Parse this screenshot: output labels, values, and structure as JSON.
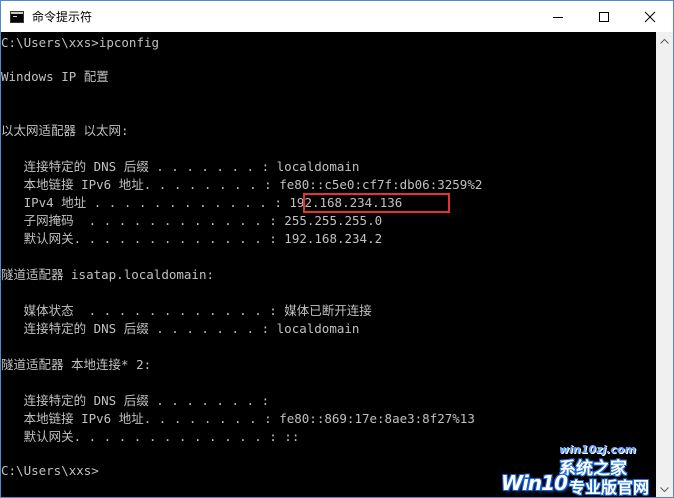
{
  "window": {
    "title": "命令提示符",
    "controls": {
      "minimize_icon": "minimize-icon",
      "maximize_icon": "maximize-icon",
      "close_icon": "close-icon"
    }
  },
  "console": {
    "lines": [
      "C:\\Users\\xxs>ipconfig",
      "",
      "Windows IP 配置",
      "",
      "",
      "以太网适配器 以太网:",
      "",
      "   连接特定的 DNS 后缀 . . . . . . . : localdomain",
      "   本地链接 IPv6 地址. . . . . . . . : fe80::c5e0:cf7f:db06:3259%2",
      "   IPv4 地址 . . . . . . . . . . . . : 192.168.234.136",
      "   子网掩码  . . . . . . . . . . . . : 255.255.255.0",
      "   默认网关. . . . . . . . . . . . . : 192.168.234.2",
      "",
      "隧道适配器 isatap.localdomain:",
      "",
      "   媒体状态  . . . . . . . . . . . . : 媒体已断开连接",
      "   连接特定的 DNS 后缀 . . . . . . . : localdomain",
      "",
      "隧道适配器 本地连接* 2:",
      "",
      "   连接特定的 DNS 后缀 . . . . . . . :",
      "   本地链接 IPv6 地址. . . . . . . . : fe80::869:17e:8ae3:8f27%13",
      "   默认网关. . . . . . . . . . . . . : ::",
      "",
      "C:\\Users\\xxs>"
    ]
  },
  "watermark": {
    "url": "win10zj.com",
    "logo": "Win10",
    "name": "系统之家",
    "subtitle": "专业版官网"
  },
  "colors": {
    "console_bg": "#000000",
    "console_text": "#c0c0c0",
    "highlight_border": "#e53333",
    "titlebar_bg": "#ffffff",
    "window_border": "#4c8ad2"
  }
}
